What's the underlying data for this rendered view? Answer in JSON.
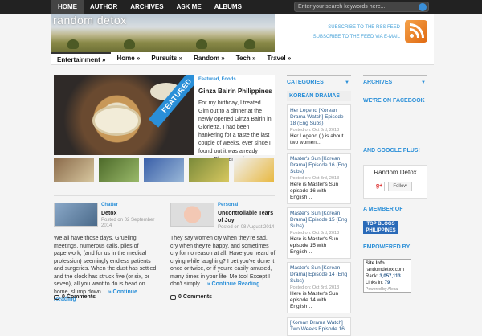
{
  "topnav": {
    "items": [
      {
        "label": "HOME",
        "active": true
      },
      {
        "label": "AUTHOR",
        "active": false
      },
      {
        "label": "ARCHIVES",
        "active": false
      },
      {
        "label": "ASK ME",
        "active": false
      },
      {
        "label": "ALBUMS",
        "active": false
      }
    ],
    "search_placeholder": "Enter your search keywords here..."
  },
  "header": {
    "site_title": "random detox",
    "rss_link": "SUBSCRIBE TO THE RSS FEED",
    "email_link": "SUBSCRIBE TO THE FEED VIA E-MAIL",
    "rss_icon": "rss-icon",
    "rss_color": "#e8821e"
  },
  "catnav": {
    "items": [
      "Entertainment »",
      "Home »",
      "Pursuits »",
      "Random »",
      "Tech »",
      "Travel »"
    ]
  },
  "featured": {
    "badge": "FEATURED",
    "categories": "Featured, Foods",
    "title": "Ginza Bairin Philippines",
    "excerpt": "For my birthday, I treated Gim out to a dinner at the newly opened Ginza Bairin in Glorietta. I had been hankering for a taste the last couple of weeks, ever since I found out it was already open. Blogger reviews say"
  },
  "posts": [
    {
      "category": "Chatter",
      "title": "Detox",
      "meta": "Posted on 02 September 2014",
      "excerpt": "We all have those days. Grueling meetings, numerous calls, piles of paperwork, (and for us in the medical profession) seemingly endless patients and surgeries. When the dust has settled and the clock has struck five (or six, or seven), all you want to do is head on home, slump down…",
      "more": "» Continue Reading",
      "comments": "0 Comments"
    },
    {
      "category": "Personal",
      "title": "Uncontrollable Tears of Joy",
      "meta": "Posted on 08 August 2014",
      "excerpt": "They say women cry when they're sad, cry when they're happy, and sometimes cry for no reason at all. Have you heard of crying while laughing? I bet you've done it once or twice, or if you're easily amused, many times in your life.  Me too! Except I don't simply…",
      "more": "» Continue Reading",
      "comments": "0 Comments"
    }
  ],
  "middle": {
    "categories_head": "CATEGORIES",
    "korean_head": "KOREAN DRAMAS",
    "entries": [
      {
        "title": "Her Legend [Korean Drama Watch] Episode 18 (Eng Subs)",
        "meta": "Posted on: Oct 3rd, 2013",
        "excerpt": "Her Legend (        ) is about two women…"
      },
      {
        "title": "Master's Sun [Korean Drama] Episode 16 (Eng Subs)",
        "meta": "Posted on: Oct 3rd, 2013",
        "excerpt": "Here is Master's Sun episode 16 with English…"
      },
      {
        "title": "Master's Sun [Korean Drama] Episode 15 (Eng Subs)",
        "meta": "Posted on: Oct 3rd, 2013",
        "excerpt": "Here is Master's Sun episode 15 with English…"
      },
      {
        "title": "Master's Sun [Korean Drama] Episode 14 (Eng Subs)",
        "meta": "Posted on: Oct 3rd, 2013",
        "excerpt": "Here is Master's Sun episode 14 with English…"
      },
      {
        "title": "[Korean Drama Watch] Two Weeks Episode 16",
        "meta": "",
        "excerpt": ""
      }
    ]
  },
  "right": {
    "archives_head": "ARCHIVES",
    "facebook": "WE'RE ON FACEBOOK",
    "gplus": "AND GOOGLE PLUS!",
    "gbox_name": "Random Detox",
    "gbox_icon": "g+",
    "gbox_follow": "Follow",
    "member": "A MEMBER OF",
    "topblogs_line1": "TOP BLOGS",
    "topblogs_line2": "PHILIPPINES",
    "empowered": "EMPOWERED BY",
    "siteinfo": {
      "title": "Site Info",
      "domain": "randomdetox.com",
      "rank_label": "Rank:",
      "rank": "3,057,113",
      "links_label": "Links in:",
      "links": "79",
      "powered": "Powered by Alexa"
    }
  }
}
